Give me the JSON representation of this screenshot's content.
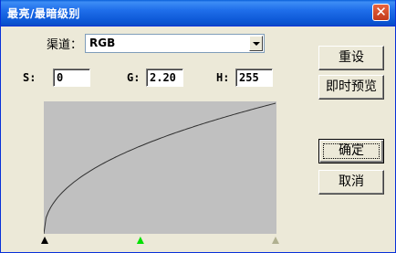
{
  "window": {
    "title": "最亮/最暗级别",
    "close_glyph": "✕"
  },
  "channel": {
    "label": "渠道：",
    "value": "RGB"
  },
  "levels": {
    "s_label": "S:",
    "s_value": "0",
    "g_label": "G:",
    "g_value": "2.20",
    "h_label": "H:",
    "h_value": "255"
  },
  "buttons": {
    "reset": "重设",
    "preview": "即时预览",
    "ok": "确定",
    "cancel": "取消"
  },
  "curve": {
    "gamma": 2.2,
    "input_min": 0,
    "input_max": 255,
    "output_min": 0,
    "output_max": 255
  },
  "markers": {
    "shadow": {
      "value": 0,
      "color": "#000000"
    },
    "gamma": {
      "value": 2.2,
      "color": "#00e000"
    },
    "highlight": {
      "value": 255,
      "color": "#b0b090"
    }
  },
  "colors": {
    "plot_bg": "#c0c0c0",
    "curve": "#303030",
    "title_bar": "#0b55d4"
  }
}
